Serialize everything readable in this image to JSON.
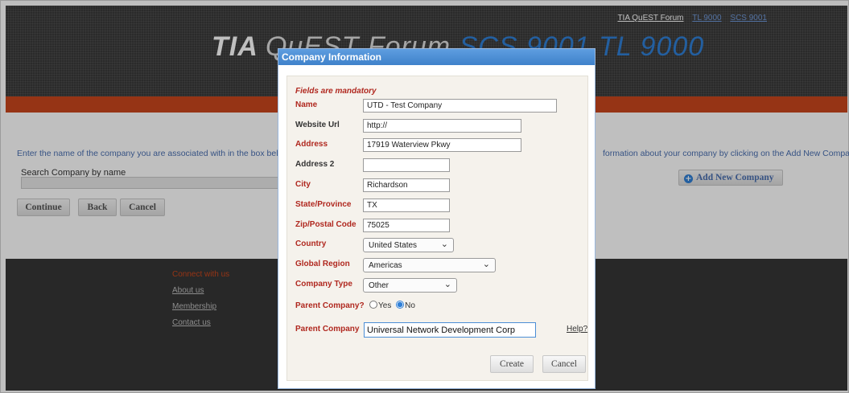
{
  "top_links": [
    "TIA QuEST Forum",
    "TL 9000",
    "SCS 9001"
  ],
  "logo": {
    "tia": "TIA",
    "quest": "QuEST Forum",
    "sub": "SCS 9001 TL 9000"
  },
  "page": {
    "intro_left": "Enter the name of the company you are associated with in the box below and s",
    "intro_right": "formation about your company by clicking on the Add New Company button",
    "search_label": "Search Company by name",
    "search_value": "",
    "buttons": {
      "continue": "Continue",
      "back": "Back",
      "cancel": "Cancel"
    },
    "add_company": "Add New Company"
  },
  "footer": {
    "connect": "Connect with us",
    "links": [
      "About us",
      "Membership",
      "Contact us"
    ]
  },
  "modal": {
    "title": "Company Information",
    "mandatory_note": "Fields are mandatory",
    "fields": {
      "name": {
        "label": "Name",
        "value": "UTD - Test Company"
      },
      "website": {
        "label": "Website Url",
        "value": "http://"
      },
      "address": {
        "label": "Address",
        "value": "17919 Waterview Pkwy"
      },
      "address2": {
        "label": "Address 2",
        "value": ""
      },
      "city": {
        "label": "City",
        "value": "Richardson"
      },
      "state": {
        "label": "State/Province",
        "value": "TX"
      },
      "zip": {
        "label": "Zip/Postal Code",
        "value": "75025"
      },
      "country": {
        "label": "Country",
        "value": "United States"
      },
      "region": {
        "label": "Global Region",
        "value": "Americas"
      },
      "company_type": {
        "label": "Company Type",
        "value": "Other"
      },
      "parent_company_q": {
        "label": "Parent Company?",
        "yes": "Yes",
        "no": "No",
        "selected": "No"
      },
      "parent_company": {
        "label": "Parent Company",
        "value": "Universal Network Development Corp",
        "help": "Help?"
      }
    },
    "buttons": {
      "create": "Create",
      "cancel": "Cancel"
    }
  },
  "colors": {
    "required_label": "#b0281f",
    "title_bar": "#4b8ed6",
    "header_bar": "#c8461c"
  }
}
